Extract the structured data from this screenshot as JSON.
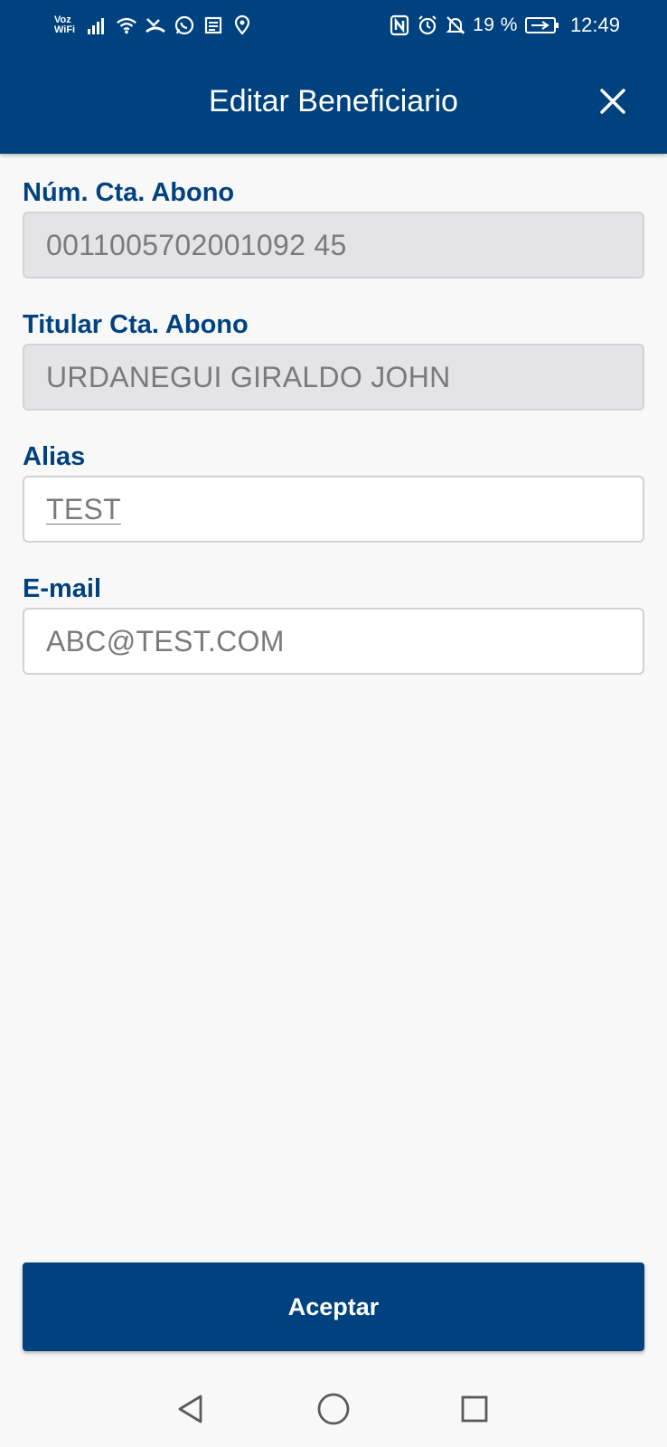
{
  "status_bar": {
    "voz_label": "Voz",
    "wifi_label": "WiFi",
    "battery_percent": "19 %",
    "time": "12:49",
    "icons": [
      "signal-icon",
      "wifi-icon",
      "missed-call-icon",
      "whatsapp-icon",
      "news-icon",
      "location-icon",
      "nfc-icon",
      "alarm-icon",
      "mute-icon",
      "battery-charging-icon"
    ]
  },
  "app_bar": {
    "title": "Editar Beneficiario",
    "close_icon": "close-icon"
  },
  "form": {
    "account_number": {
      "label": "Núm. Cta. Abono",
      "value": "0011005702001092 45"
    },
    "account_holder": {
      "label": "Titular Cta. Abono",
      "value": "URDANEGUI GIRALDO JOHN"
    },
    "alias": {
      "label": "Alias",
      "value": "TEST"
    },
    "email": {
      "label": "E-mail",
      "value": "ABC@TEST.COM"
    }
  },
  "accept_button": {
    "label": "Aceptar"
  },
  "navigation": {
    "back_icon": "back-triangle-icon",
    "home_icon": "home-circle-icon",
    "recent_icon": "recents-square-icon"
  },
  "colors": {
    "brand_blue": "#00427f",
    "background": "#f8f8f9",
    "disabled_field": "#e4e4e6",
    "field_text": "#7a7a7c"
  }
}
